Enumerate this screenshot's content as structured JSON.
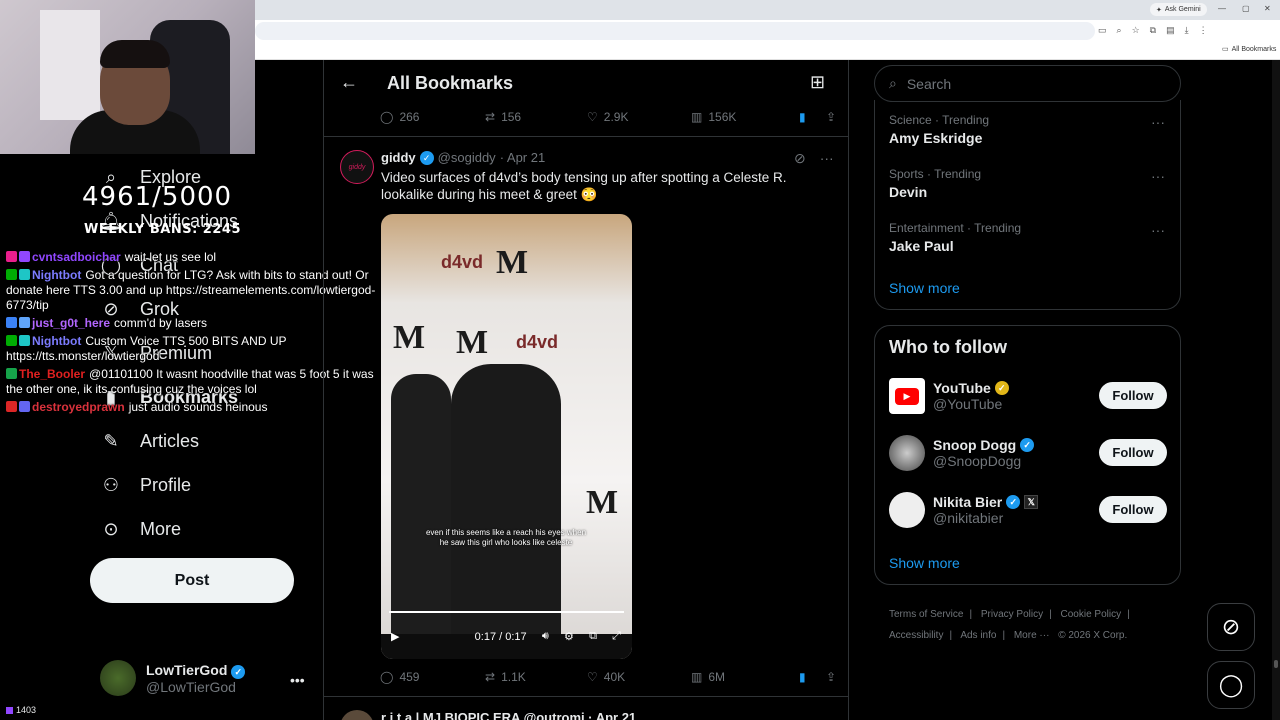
{
  "browser": {
    "gemini_label": "Ask Gemini",
    "bookmarks_label": "All Bookmarks"
  },
  "overlay": {
    "counter": "4961/5000",
    "weekly": "WEEKLY BANS: 2245",
    "sub_count": "1403"
  },
  "nav": {
    "items": [
      {
        "label": "Explore",
        "icon": "search-icon"
      },
      {
        "label": "Notifications",
        "icon": "bell-icon"
      },
      {
        "label": "Chat",
        "icon": "chat-icon"
      },
      {
        "label": "Grok",
        "icon": "grok-icon"
      },
      {
        "label": "Premium",
        "icon": "x-icon"
      },
      {
        "label": "Bookmarks",
        "icon": "bookmark-icon"
      },
      {
        "label": "Articles",
        "icon": "article-icon"
      },
      {
        "label": "Profile",
        "icon": "person-icon"
      },
      {
        "label": "More",
        "icon": "more-circle-icon"
      }
    ],
    "post_label": "Post",
    "profile": {
      "name": "LowTierGod",
      "handle": "@LowTierGod"
    }
  },
  "chat": [
    {
      "user": "cvntsadboichar",
      "color": "#9147ff",
      "msg": "wait let us see lol"
    },
    {
      "user": "Nightbot",
      "color": "#7c7cff",
      "msg": "Got a question for LTG? Ask with bits to stand out! Or donate here TTS 3.00 and up https://streamelements.com/lowtiergod-6773/tip"
    },
    {
      "user": "just_g0t_here",
      "color": "#b366ff",
      "msg": "comm'd by lasers"
    },
    {
      "user": "Nightbot",
      "color": "#7c7cff",
      "msg": "Custom Voice TTS 500 BITS AND UP https://tts.monster/lowtiergod"
    },
    {
      "user": "The_Booler",
      "color": "#e02020",
      "msg": "@01101100 It wasnt hoodville that was 5 foot 5 it was the other one, ik its confusing cuz the voices lol"
    },
    {
      "user": "destroyedprawn",
      "color": "#d9323c",
      "msg": "just audio sounds heinous"
    }
  ],
  "main": {
    "title": "All Bookmarks",
    "prev_actions": {
      "replies": "266",
      "reposts": "156",
      "likes": "2.9K",
      "views": "156K"
    },
    "tweet": {
      "avatar_text": "giddy",
      "name": "giddy",
      "handle": "@sogiddy",
      "date": "· Apr 21",
      "text": "Video surfaces of d4vd’s body tensing up after spotting a Celeste R. lookalike during his meet & greet 😳",
      "video_caption": "even if this seems like a reach his eyes when he saw this girl who looks like celeste",
      "video_time": "0:17 / 0:17",
      "actions": {
        "replies": "459",
        "reposts": "1.1K",
        "likes": "40K",
        "views": "6M"
      }
    },
    "next_tweet_head": "r i t a | MJ BIOPIC ERA @outromi · Apr 21"
  },
  "sidebar": {
    "search_placeholder": "Search",
    "trends": [
      {
        "meta": "Science · Trending",
        "name": "Amy Eskridge"
      },
      {
        "meta": "Sports · Trending",
        "name": "Devin"
      },
      {
        "meta": "Entertainment · Trending",
        "name": "Jake Paul"
      }
    ],
    "show_more": "Show more",
    "who_to_follow_title": "Who to follow",
    "follow_label": "Follow",
    "follows": [
      {
        "name": "YouTube",
        "handle": "@YouTube",
        "badge": "gold"
      },
      {
        "name": "Snoop Dogg",
        "handle": "@SnoopDogg",
        "badge": "blue"
      },
      {
        "name": "Nikita Bier",
        "handle": "@nikitabier",
        "badge": "blue"
      }
    ],
    "footer": [
      "Terms of Service",
      "|",
      "Privacy Policy",
      "|",
      "Cookie Policy",
      "|",
      "Accessibility",
      "|",
      "Ads info",
      "|",
      "More ···",
      "© 2026 X Corp."
    ]
  }
}
